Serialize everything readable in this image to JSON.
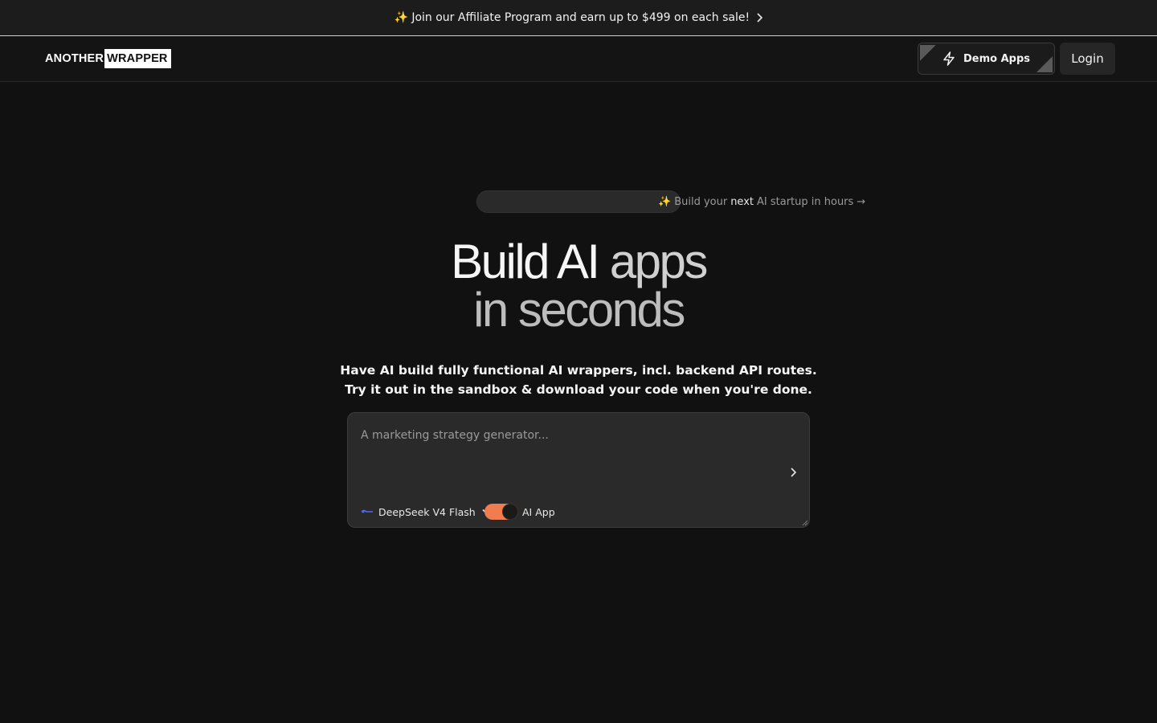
{
  "announcement": {
    "icon": "sparkles-icon",
    "text": "Join our Affiliate Program and earn up to $499 on each sale!"
  },
  "header": {
    "logo": {
      "part1": "ANOTHER",
      "part2": "WRAPPER"
    },
    "demo_apps_label": "Demo Apps",
    "login_label": "Login"
  },
  "hero": {
    "pill_icon": "sparkles-icon",
    "pill_pre": "Build your",
    "pill_highlight": "next",
    "pill_post": "AI startup in hours",
    "pill_arrow": "→",
    "title_line1_a": "Build AI",
    "title_line1_b": "apps",
    "title_line2": "in seconds",
    "subtitle": "Have AI build fully functional AI wrappers, incl. backend API routes. Try it out in the sandbox & download your code when you're done."
  },
  "prompt": {
    "placeholder": "A marketing strategy generator...",
    "value": "",
    "model_label": "DeepSeek V4 Flash",
    "toggle_label": "AI App",
    "toggle_on": true
  },
  "colors": {
    "background": "#111111",
    "accent": "#f07c4f",
    "model_logo": "#4d6bfe"
  }
}
